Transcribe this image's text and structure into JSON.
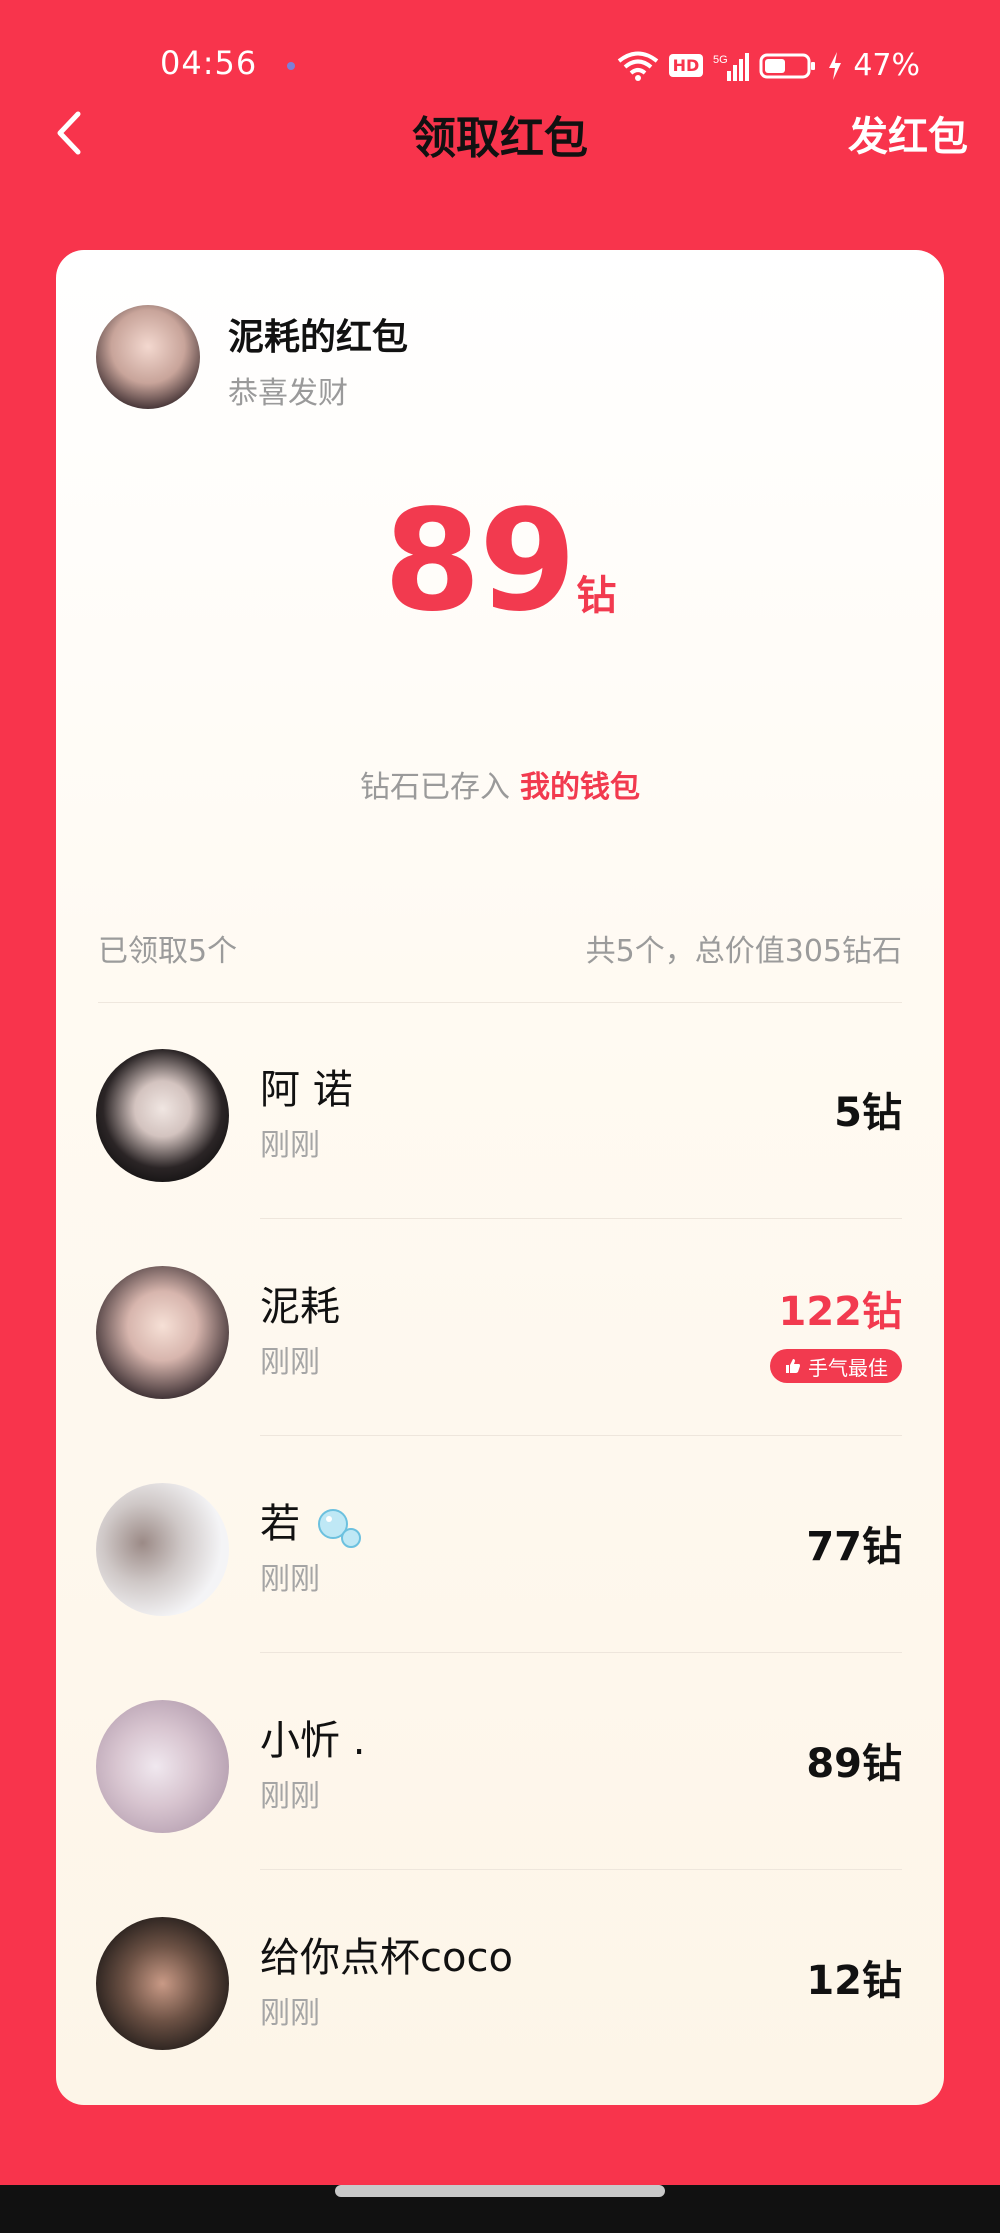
{
  "status_bar": {
    "time": "04:56",
    "network": "5G",
    "hd_label": "HD",
    "battery_percent": "47%"
  },
  "nav": {
    "title": "领取红包",
    "send_label": "发红包",
    "back_icon": "chevron-left-icon"
  },
  "packet": {
    "sender_name": "泥耗的红包",
    "wish": "恭喜发财",
    "amount": "89",
    "unit": "钻",
    "saved_text": "钻石已存入",
    "wallet_link": "我的钱包",
    "claimed_summary": "已领取5个",
    "total_summary": "共5个，总价值305钻石"
  },
  "recipients": [
    {
      "name": "阿 诺",
      "time": "刚刚",
      "diamonds": "5钻",
      "best": false
    },
    {
      "name": "泥耗",
      "time": "刚刚",
      "diamonds": "122钻",
      "best": true,
      "badge": "手气最佳"
    },
    {
      "name": "若",
      "time": "刚刚",
      "diamonds": "77钻",
      "best": false,
      "emoji_icon": "bubble-icon"
    },
    {
      "name": "小忻 .",
      "time": "刚刚",
      "diamonds": "89钻",
      "best": false
    },
    {
      "name": "给你点杯coco",
      "time": "刚刚",
      "diamonds": "12钻",
      "best": false
    }
  ],
  "colors": {
    "brand_red": "#f8344c",
    "accent_red": "#f23a4f",
    "card_bg": "#fdf5e8",
    "muted_text": "#9a9a9a"
  }
}
